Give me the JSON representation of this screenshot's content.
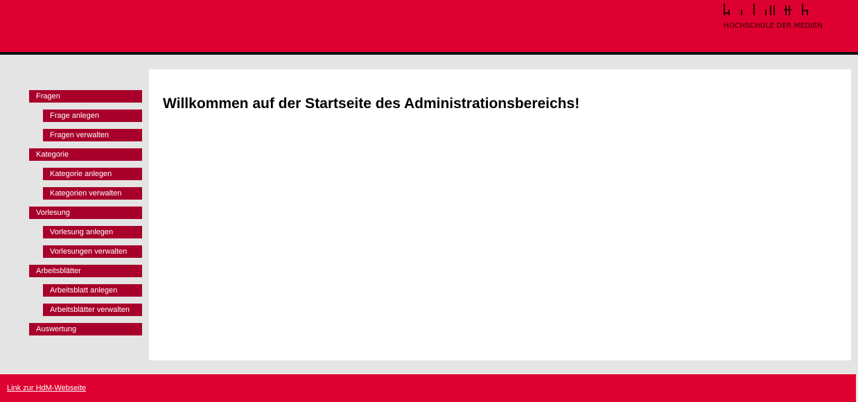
{
  "colors": {
    "brand": "#dd0030",
    "nav": "#a8002a",
    "background": "#e4e4e4"
  },
  "header": {
    "logo": {
      "icon": "hdm-logo-icon",
      "text": "HOCHSCHULE DER MEDIEN"
    }
  },
  "sidebar": {
    "items": [
      {
        "label": "Fragen"
      },
      {
        "label": "Frage anlegen"
      },
      {
        "label": "Fragen verwalten"
      },
      {
        "label": "Kategorie"
      },
      {
        "label": "Kategorie anlegen"
      },
      {
        "label": "Kategorien verwalten"
      },
      {
        "label": "Vorlesung"
      },
      {
        "label": "Vorlesung anlegen"
      },
      {
        "label": "Vorlesungen verwalten"
      },
      {
        "label": "Arbeitsblätter"
      },
      {
        "label": "Arbeitsblatt anlegen"
      },
      {
        "label": "Arbeitsblätter verwalten"
      },
      {
        "label": "Auswertung"
      }
    ]
  },
  "main": {
    "heading": "Willkommen auf der Startseite des Administrationsbereichs!"
  },
  "footer": {
    "link_label": "Link zur HdM-Webseite"
  }
}
